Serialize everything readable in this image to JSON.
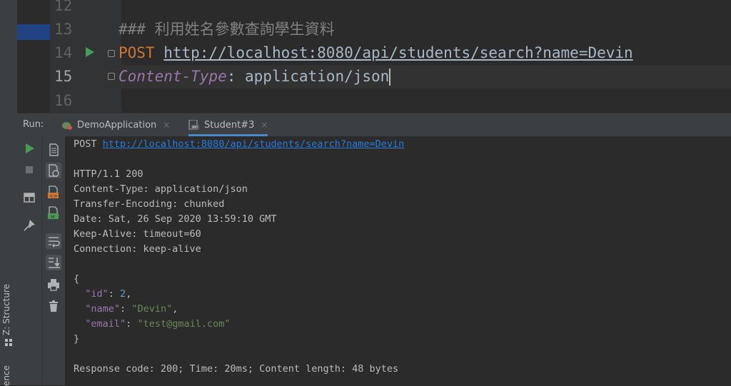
{
  "editor": {
    "lines": [
      {
        "number": "12",
        "text": ""
      },
      {
        "number": "13",
        "comment": "### 利用姓名參數查詢學生資料"
      },
      {
        "number": "14",
        "method": "POST",
        "url": "http://localhost:8080/api/students/search?name=Devin"
      },
      {
        "number": "15",
        "header_name": "Content-Type",
        "header_sep": ": ",
        "header_value": "application/json"
      },
      {
        "number": "16",
        "text": ""
      }
    ]
  },
  "run_panel": {
    "title": "Run:",
    "tabs": [
      {
        "label": "DemoApplication",
        "close": "×",
        "active": false
      },
      {
        "label": "Student#3",
        "close": "×",
        "active": true
      }
    ]
  },
  "side_strip": {
    "structure_label": "Z: Structure",
    "bottom_label": "ence"
  },
  "console": {
    "request_method": "POST",
    "request_url": "http://localhost:8080/api/students/search?name=Devin",
    "status_line": "HTTP/1.1 200",
    "headers": [
      "Content-Type: application/json",
      "Transfer-Encoding: chunked",
      "Date: Sat, 26 Sep 2020 13:59:10 GMT",
      "Keep-Alive: timeout=60",
      "Connection: keep-alive"
    ],
    "json_open": "{",
    "json_fields": [
      {
        "key": "\"id\"",
        "value": "2",
        "type": "number",
        "trail": ","
      },
      {
        "key": "\"name\"",
        "value": "\"Devin\"",
        "type": "string",
        "trail": ","
      },
      {
        "key": "\"email\"",
        "value": "\"test@gmail.com\"",
        "type": "string",
        "trail": ""
      }
    ],
    "json_close": "}",
    "summary": "Response code: 200; Time: 20ms; Content length: 48 bytes"
  },
  "colors": {
    "background": "#2b2b2b",
    "keyword": "#cc7832",
    "header_name": "#9876aa",
    "link": "#287bde",
    "run_green": "#499c54",
    "json_string": "#6a8759",
    "json_number": "#6897bb"
  }
}
